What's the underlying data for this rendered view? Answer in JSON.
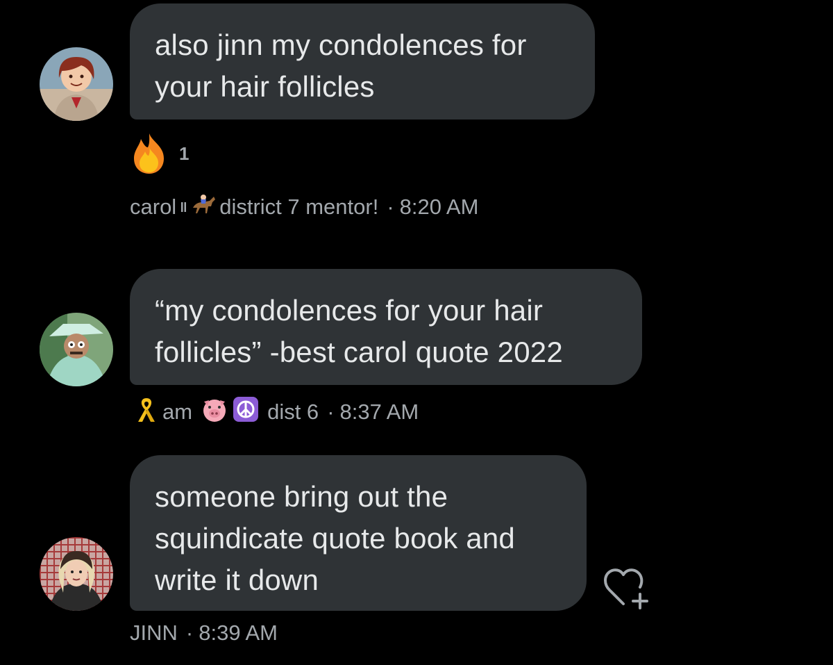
{
  "messages": [
    {
      "text_lines": [
        "also jinn my condolences for",
        "your hair follicles"
      ],
      "reaction": {
        "icon": "fire-emoji",
        "count": "1"
      },
      "sender": "carol",
      "sender_suffix": "district 7 mentor!",
      "time": "8:20 AM"
    },
    {
      "text_lines": [
        "“my condolences for your hair",
        "follicles” -best carol quote 2022"
      ],
      "sender": "am",
      "sender_suffix": "dist 6",
      "time": "8:37 AM"
    },
    {
      "text_lines": [
        "someone bring out the",
        "squindicate quote book and",
        "write it down"
      ],
      "sender": "JINN",
      "time": "8:39 AM",
      "action_icon": "heart-plus-icon"
    }
  ],
  "colors": {
    "background": "#000000",
    "bubble": "#2f3336",
    "text": "#e7e9ea",
    "meta_text": "#a3a8ad"
  }
}
